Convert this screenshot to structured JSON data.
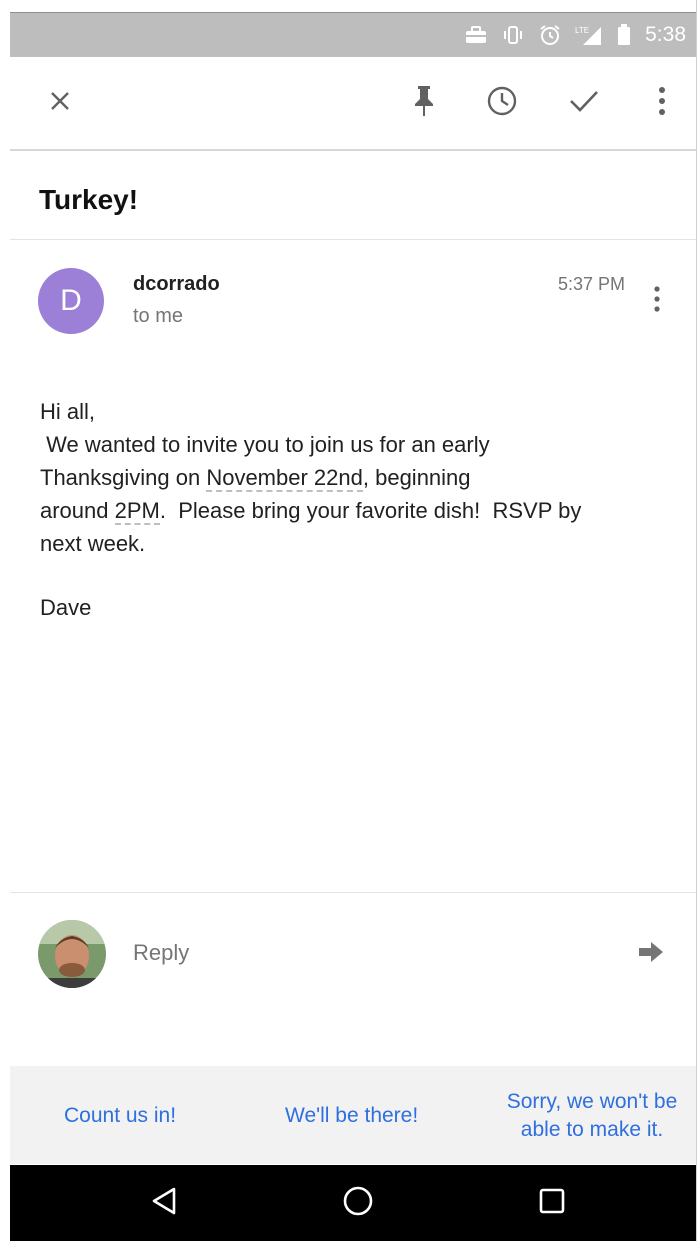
{
  "status_bar": {
    "time": "5:38",
    "icons": [
      "briefcase-icon",
      "vibrate-icon",
      "alarm-icon",
      "lte-signal-icon",
      "battery-icon"
    ]
  },
  "toolbar": {
    "icons": [
      "close-icon",
      "pin-icon",
      "snooze-clock-icon",
      "done-check-icon",
      "more-vert-icon"
    ]
  },
  "email": {
    "subject": "Turkey!",
    "sender": {
      "initial": "D",
      "name": "dcorrado",
      "recipient": "to me",
      "time": "5:37 PM",
      "avatar_color": "#9c7fd6"
    },
    "body": {
      "greeting": "Hi all,",
      "line1_pre": " We wanted to invite you to join us for an early",
      "line2_pre": "Thanksgiving on ",
      "date": "November 22nd",
      "line2_post": ", beginning",
      "line3_pre": "around ",
      "time": "2PM",
      "line3_post": ".  Please bring your favorite dish!  RSVP by",
      "line4": "next week.",
      "signature": "Dave"
    }
  },
  "reply": {
    "label": "Reply"
  },
  "smart_replies": [
    "Count us in!",
    "We'll be there!",
    "Sorry, we won't be able to make it."
  ],
  "smart_reply_lines": {
    "third_line1": "Sorry, we won't be",
    "third_line2": "able to make it."
  },
  "colors": {
    "accent": "#2f6fe0",
    "status_bar": "#bdbdbd",
    "nav_bar": "#000000",
    "smart_bar": "#f2f2f2"
  }
}
